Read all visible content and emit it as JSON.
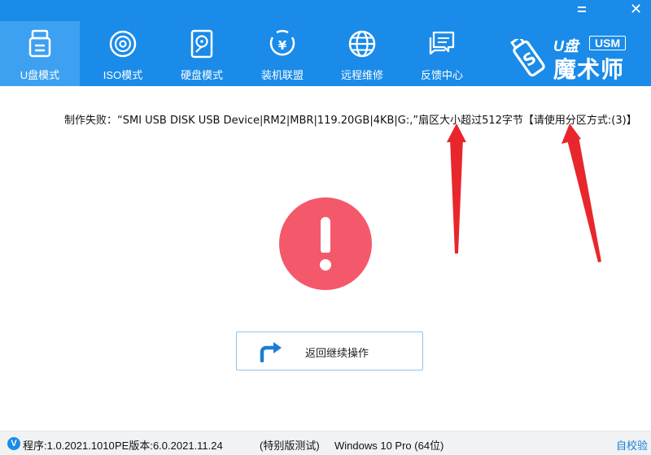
{
  "window": {
    "minimize_icon": "menu-icon",
    "close_label": "✕"
  },
  "tabs": [
    {
      "label": "U盘模式",
      "icon": "usb-drive-icon",
      "active": true
    },
    {
      "label": "ISO模式",
      "icon": "disc-icon",
      "active": false
    },
    {
      "label": "硬盘模式",
      "icon": "hard-disk-icon",
      "active": false
    },
    {
      "label": "装机联盟",
      "icon": "yen-coin-icon",
      "active": false
    },
    {
      "label": "远程维修",
      "icon": "globe-icon",
      "active": false
    },
    {
      "label": "反馈中心",
      "icon": "chat-bubble-icon",
      "active": false
    }
  ],
  "logo": {
    "badge": "USM",
    "u_text": "U盘",
    "brand": "魔术师"
  },
  "message": "制作失败：“SMI USB DISK USB Device|RM2|MBR|119.20GB|4KB|G:,”扇区大小超过512字节【请使用分区方式:(3)】",
  "back_button": {
    "label": "返回继续操作"
  },
  "status": {
    "program": "程序:1.0.2021.1010",
    "pe_version": "PE版本:6.0.2021.11.24",
    "edition": "(特别版测试)",
    "os": "Windows 10 Pro (64位)",
    "self_check": "自校验"
  },
  "colors": {
    "header": "#1a8be8",
    "active_tab": "#3ea0f0",
    "error": "#f3596a",
    "arrow": "#e8262c"
  }
}
